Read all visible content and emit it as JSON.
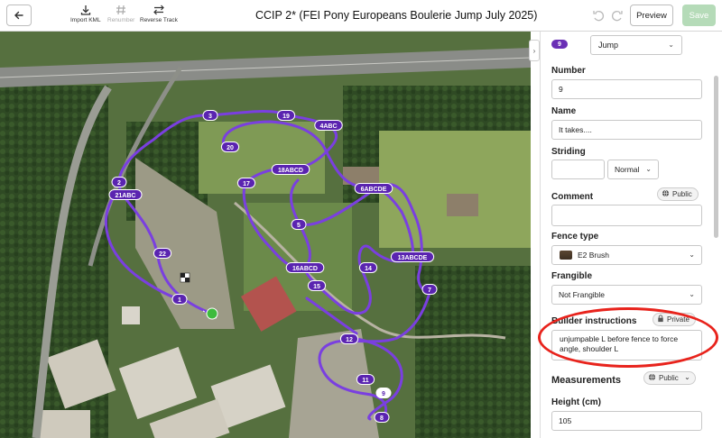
{
  "toolbar": {
    "import_kml": "Import KML",
    "renumber": "Renumber",
    "reverse_track": "Reverse Track",
    "title": "CCIP 2* (FEI Pony Europeans Boulerie Jump July 2025)",
    "preview": "Preview",
    "save": "Save"
  },
  "map": {
    "markers": [
      "3",
      "19",
      "4ABC",
      "20",
      "2",
      "18ABCD",
      "17",
      "6ABCDE",
      "21ABC",
      "5",
      "22",
      "13ABCDE",
      "14",
      "16ABCD",
      "15",
      "7",
      "1",
      "12",
      "11",
      "9",
      "8"
    ],
    "track_color": "#7a3fe0",
    "start_color": "#3dbb3d"
  },
  "panel": {
    "badge": "9",
    "type_value": "Jump",
    "number_label": "Number",
    "number_value": "9",
    "name_label": "Name",
    "name_value": "It takes....",
    "striding_label": "Striding",
    "striding_value": "",
    "striding_select": "Normal",
    "comment_label": "Comment",
    "comment_visibility": "Public",
    "comment_value": "",
    "fence_type_label": "Fence type",
    "fence_type_value": "E2 Brush",
    "frangible_label": "Frangible",
    "frangible_value": "Not Frangible",
    "builder_label": "Builder instructions",
    "builder_visibility": "Private",
    "builder_value": "unjumpable L before fence to force angle, shoulder L",
    "measurements_label": "Measurements",
    "measurements_visibility": "Public",
    "height_label": "Height (cm)",
    "height_value": "105"
  }
}
